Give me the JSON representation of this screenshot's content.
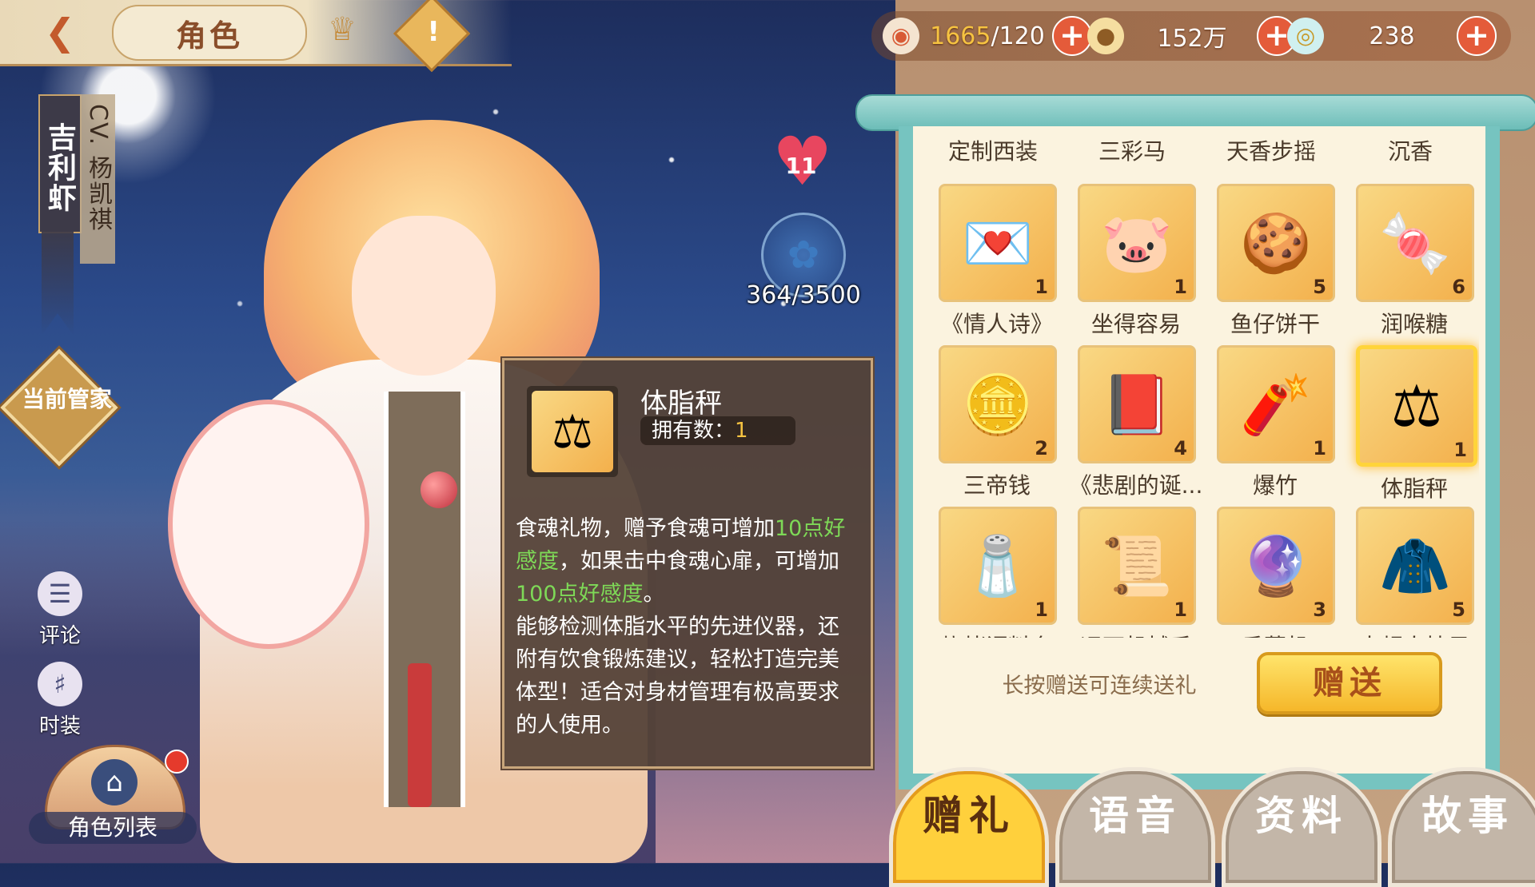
{
  "header": {
    "title": "角色"
  },
  "character": {
    "name": "吉利虾",
    "cv": "CV. 杨凯祺"
  },
  "sidebar": {
    "manager_label": "当前管家",
    "comment_label": "评论",
    "fashion_label": "时装",
    "role_list_label": "角色列表"
  },
  "affection": {
    "level": "11",
    "value": "364/3500"
  },
  "currency": {
    "stamina_current": "1665",
    "stamina_max": "/120",
    "gold": "152万",
    "jade": "238",
    "plus": "+"
  },
  "gifts": {
    "column_headers": [
      "定制西装",
      "三彩马",
      "天香步摇",
      "沉香"
    ],
    "items": [
      {
        "name": "《情人诗》",
        "count": "1",
        "icon": "love-letter-icon",
        "emoji": "💌"
      },
      {
        "name": "坐得容易",
        "count": "1",
        "icon": "pig-cushion-icon",
        "emoji": "🐷"
      },
      {
        "name": "鱼仔饼干",
        "count": "5",
        "icon": "fish-biscuit-icon",
        "emoji": "🍪"
      },
      {
        "name": "润喉糖",
        "count": "6",
        "icon": "candy-box-icon",
        "emoji": "🍬"
      },
      {
        "name": "三帝钱",
        "count": "2",
        "icon": "coins-icon",
        "emoji": "🪙"
      },
      {
        "name": "《悲剧的诞...",
        "count": "4",
        "icon": "book-icon",
        "emoji": "📕"
      },
      {
        "name": "爆竹",
        "count": "1",
        "icon": "firecracker-icon",
        "emoji": "🧨"
      },
      {
        "name": "体脂秤",
        "count": "1",
        "icon": "scale-icon",
        "emoji": "⚖"
      },
      {
        "name": "烧烤调料套",
        "count": "1",
        "icon": "seasoning-icon",
        "emoji": "🧂"
      },
      {
        "name": "远西机械手",
        "count": "1",
        "icon": "scroll-map-icon",
        "emoji": "📜"
      },
      {
        "name": "香薰机",
        "count": "3",
        "icon": "crystal-ball-icon",
        "emoji": "🔮"
      },
      {
        "name": "大超人披风",
        "count": "5",
        "icon": "cape-icon",
        "emoji": "🧥"
      }
    ],
    "hint": "长按赠送可连续送礼",
    "send_label": "赠送"
  },
  "tabs": [
    "赠礼",
    "语音",
    "资料",
    "故事"
  ],
  "tooltip": {
    "name": "体脂秤",
    "owned_label": "拥有数：",
    "owned_count": "1",
    "desc_1": "食魂礼物，赠予食魂可增加",
    "desc_hl_1": "10点好感度",
    "desc_2": "，如果击中食魂心扉，可增加",
    "desc_hl_2": "100点好感度",
    "desc_3": "。",
    "desc_4": "能够检测体脂水平的先进仪器，还附有饮食锻炼建议，轻松打造完美体型！适合对身材管理有极高要求的人使用。"
  },
  "colors": {
    "highlight_green": "#7ed957",
    "accent_gold": "#f6c341",
    "tab_active": "#ffd03c"
  }
}
